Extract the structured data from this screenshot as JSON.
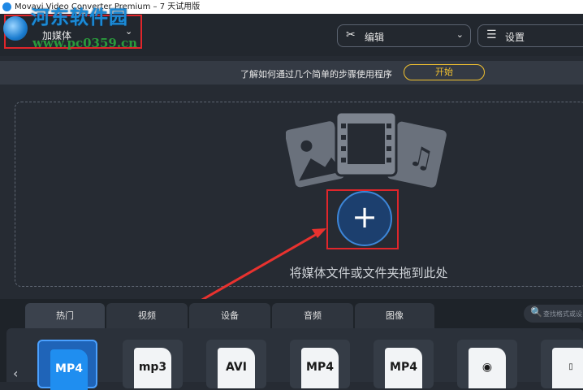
{
  "window": {
    "title": "Movavi Video Converter Premium – 7 天试用版"
  },
  "toolbar": {
    "add_media_label": "加媒体",
    "edit_label": "编辑",
    "settings_label": "设置"
  },
  "watermark": {
    "line1": "河东软件园",
    "line2": "www.pc0359.cn"
  },
  "info_bar": {
    "message": "了解如何通过几个简单的步骤使用程序",
    "start_label": "开始"
  },
  "drop_zone": {
    "text": "将媒体文件或文件夹拖到此处",
    "add_symbol": "+"
  },
  "tabs": [
    "热门",
    "视频",
    "设备",
    "音频",
    "图像"
  ],
  "search": {
    "placeholder": "查找格式或设"
  },
  "formats": [
    {
      "label": "MP4",
      "icon": "mp4-icon"
    },
    {
      "label": "mp3",
      "icon": "mp3-icon"
    },
    {
      "label": "AVI",
      "icon": "avi-icon"
    },
    {
      "label": "MP4",
      "icon": "mp4-video-icon"
    },
    {
      "label": "MP4",
      "icon": "mp4-video-icon"
    },
    {
      "label": "",
      "icon": "quicktime-icon"
    },
    {
      "label": "",
      "icon": "phone-icon"
    }
  ],
  "colors": {
    "accent": "#f2c230",
    "highlight": "#e0262b",
    "brand_blue": "#1f8ef0"
  }
}
